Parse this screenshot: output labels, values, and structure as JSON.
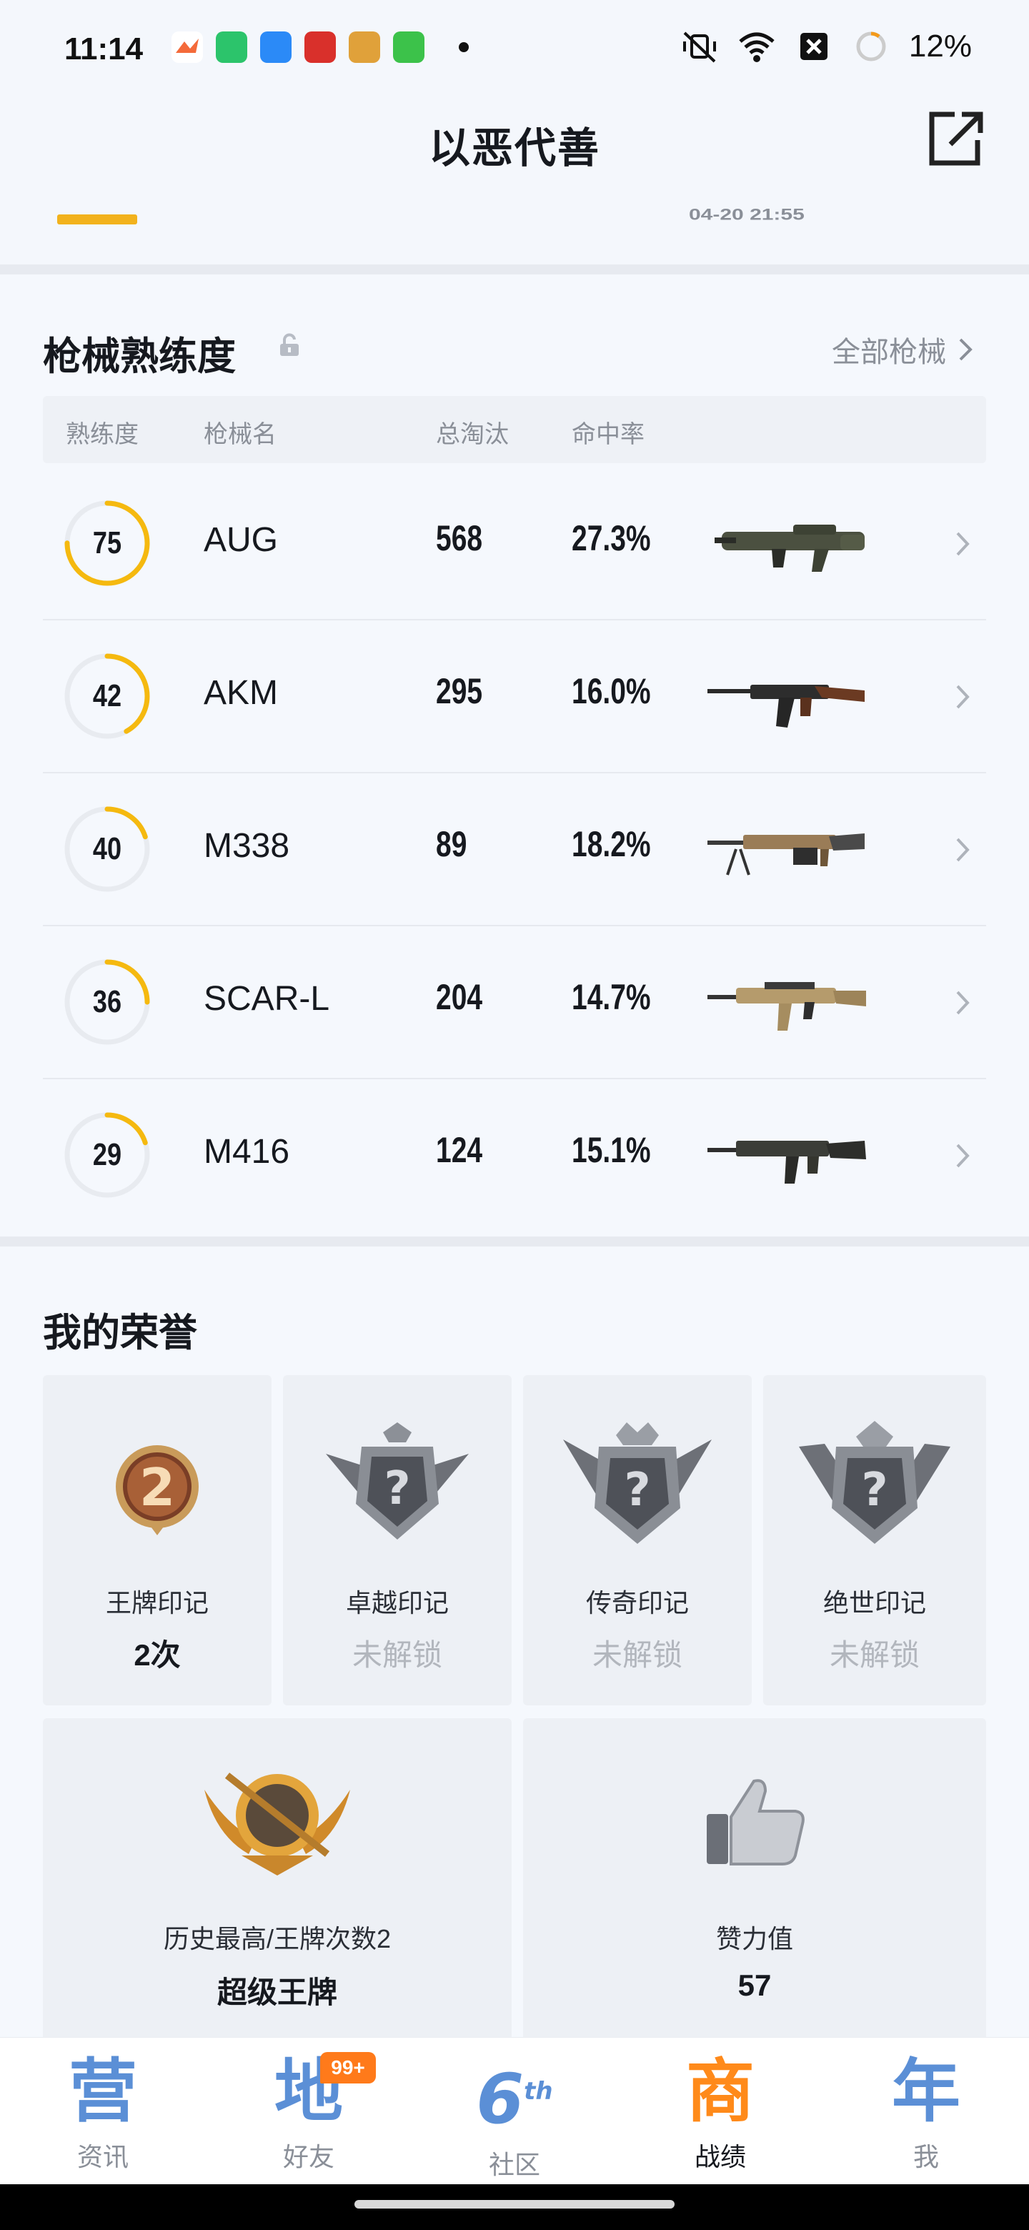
{
  "status_bar": {
    "time": "11:14",
    "battery_text": "12%"
  },
  "header": {
    "title": "以恶代善"
  },
  "peek": {
    "date": "04-20 21:55"
  },
  "weapons": {
    "title": "枪械熟练度",
    "all_link": "全部枪械",
    "columns": [
      "熟练度",
      "枪械名",
      "总淘汰",
      "命中率"
    ],
    "rows": [
      {
        "level": "75",
        "name": "AUG",
        "kills": "568",
        "accuracy": "27.3%",
        "progress": 0.75
      },
      {
        "level": "42",
        "name": "AKM",
        "kills": "295",
        "accuracy": "16.0%",
        "progress": 0.42
      },
      {
        "level": "40",
        "name": "M338",
        "kills": "89",
        "accuracy": "18.2%",
        "progress": 0.2
      },
      {
        "level": "36",
        "name": "SCAR-L",
        "kills": "204",
        "accuracy": "14.7%",
        "progress": 0.25
      },
      {
        "level": "29",
        "name": "M416",
        "kills": "124",
        "accuracy": "15.1%",
        "progress": 0.2
      }
    ]
  },
  "honors": {
    "title": "我的荣誉",
    "marks": [
      {
        "label": "王牌印记",
        "value": "2次",
        "locked": false
      },
      {
        "label": "卓越印记",
        "value": "未解锁",
        "locked": true
      },
      {
        "label": "传奇印记",
        "value": "未解锁",
        "locked": true
      },
      {
        "label": "绝世印记",
        "value": "未解锁",
        "locked": true
      }
    ],
    "badge_num": "2",
    "best": {
      "label": "历史最高/王牌次数2",
      "value": "超级王牌"
    },
    "likes": {
      "label": "赞力值",
      "value": "57"
    }
  },
  "bottom_nav": {
    "items": [
      {
        "glyph": "营",
        "label": "资讯"
      },
      {
        "glyph": "地",
        "label": "好友"
      },
      {
        "glyph": "6",
        "label": "社区"
      },
      {
        "glyph": "商",
        "label": "战绩"
      },
      {
        "glyph": "年",
        "label": "我"
      }
    ],
    "friends_badge": "99+",
    "community_sup": "th"
  },
  "colors": {
    "ring_active": "#f5b90f",
    "ring_track": "#e8ebf0",
    "nav_blue": "#5b8fd6",
    "nav_orange": "#ff8a1a"
  }
}
